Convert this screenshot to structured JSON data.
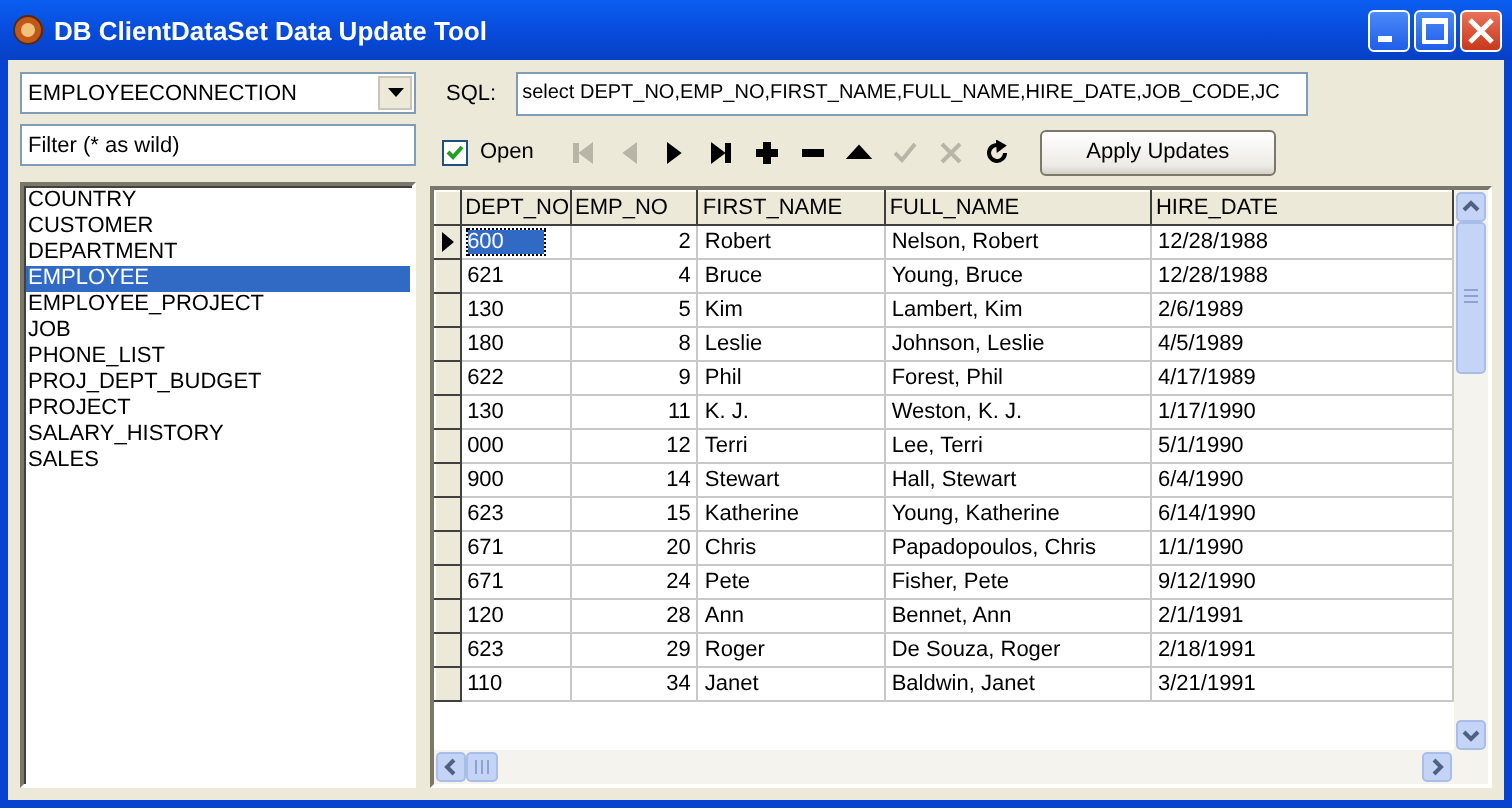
{
  "window": {
    "title": "DB ClientDataSet Data Update Tool"
  },
  "connection": {
    "value": "EMPLOYEECONNECTION"
  },
  "filter": {
    "value": "Filter (* as wild)"
  },
  "tables": [
    {
      "label": "COUNTRY",
      "selected": false
    },
    {
      "label": "CUSTOMER",
      "selected": false
    },
    {
      "label": "DEPARTMENT",
      "selected": false
    },
    {
      "label": "EMPLOYEE",
      "selected": true
    },
    {
      "label": "EMPLOYEE_PROJECT",
      "selected": false
    },
    {
      "label": "JOB",
      "selected": false
    },
    {
      "label": "PHONE_LIST",
      "selected": false
    },
    {
      "label": "PROJ_DEPT_BUDGET",
      "selected": false
    },
    {
      "label": "PROJECT",
      "selected": false
    },
    {
      "label": "SALARY_HISTORY",
      "selected": false
    },
    {
      "label": "SALES",
      "selected": false
    }
  ],
  "sql": {
    "label": "SQL:",
    "value": "select DEPT_NO,EMP_NO,FIRST_NAME,FULL_NAME,HIRE_DATE,JOB_CODE,JC"
  },
  "open": {
    "label": "Open",
    "checked": true
  },
  "navigator": [
    {
      "kind": "first",
      "disabled": true
    },
    {
      "kind": "prior",
      "disabled": true
    },
    {
      "kind": "next",
      "disabled": false
    },
    {
      "kind": "last",
      "disabled": false
    },
    {
      "kind": "insert",
      "disabled": false
    },
    {
      "kind": "delete",
      "disabled": false
    },
    {
      "kind": "edit",
      "disabled": false
    },
    {
      "kind": "post",
      "disabled": true
    },
    {
      "kind": "cancel",
      "disabled": true
    },
    {
      "kind": "refresh",
      "disabled": false
    }
  ],
  "apply_button": {
    "label": "Apply Updates"
  },
  "grid": {
    "columns": [
      {
        "label": "DEPT_NO"
      },
      {
        "label": "EMP_NO"
      },
      {
        "label": "FIRST_NAME"
      },
      {
        "label": "FULL_NAME"
      },
      {
        "label": "HIRE_DATE"
      }
    ],
    "rows": [
      {
        "selected": true,
        "cells": [
          "600",
          "2",
          "Robert",
          "Nelson, Robert",
          "12/28/1988"
        ]
      },
      {
        "selected": false,
        "cells": [
          "621",
          "4",
          "Bruce",
          "Young, Bruce",
          "12/28/1988"
        ]
      },
      {
        "selected": false,
        "cells": [
          "130",
          "5",
          "Kim",
          "Lambert, Kim",
          "2/6/1989"
        ]
      },
      {
        "selected": false,
        "cells": [
          "180",
          "8",
          "Leslie",
          "Johnson, Leslie",
          "4/5/1989"
        ]
      },
      {
        "selected": false,
        "cells": [
          "622",
          "9",
          "Phil",
          "Forest, Phil",
          "4/17/1989"
        ]
      },
      {
        "selected": false,
        "cells": [
          "130",
          "11",
          "K. J.",
          "Weston, K. J.",
          "1/17/1990"
        ]
      },
      {
        "selected": false,
        "cells": [
          "000",
          "12",
          "Terri",
          "Lee, Terri",
          "5/1/1990"
        ]
      },
      {
        "selected": false,
        "cells": [
          "900",
          "14",
          "Stewart",
          "Hall, Stewart",
          "6/4/1990"
        ]
      },
      {
        "selected": false,
        "cells": [
          "623",
          "15",
          "Katherine",
          "Young, Katherine",
          "6/14/1990"
        ]
      },
      {
        "selected": false,
        "cells": [
          "671",
          "20",
          "Chris",
          "Papadopoulos, Chris",
          "1/1/1990"
        ]
      },
      {
        "selected": false,
        "cells": [
          "671",
          "24",
          "Pete",
          "Fisher, Pete",
          "9/12/1990"
        ]
      },
      {
        "selected": false,
        "cells": [
          "120",
          "28",
          "Ann",
          "Bennet, Ann",
          "2/1/1991"
        ]
      },
      {
        "selected": false,
        "cells": [
          "623",
          "29",
          "Roger",
          "De Souza, Roger",
          "2/18/1991"
        ]
      },
      {
        "selected": false,
        "cells": [
          "110",
          "34",
          "Janet",
          "Baldwin, Janet",
          "3/21/1991"
        ]
      }
    ]
  }
}
